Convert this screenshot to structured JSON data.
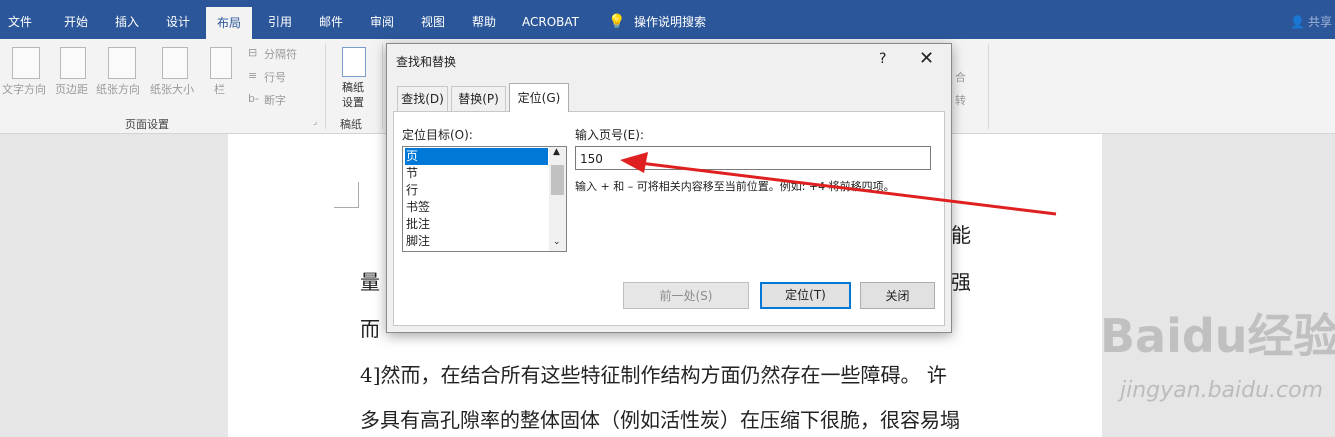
{
  "tabs": [
    "文件",
    "开始",
    "插入",
    "设计",
    "布局",
    "引用",
    "邮件",
    "审阅",
    "视图",
    "帮助",
    "ACROBAT",
    "操作说明搜索"
  ],
  "active_tab": "布局",
  "share_label": "共享",
  "ribbon": {
    "page_setup": [
      "文字方向",
      "页边距",
      "纸张方向",
      "纸张大小",
      "栏"
    ],
    "small_buttons": [
      "分隔符",
      "行号",
      "断字"
    ],
    "group_page_setup": "页面设置",
    "draft": [
      "稿纸",
      "设置"
    ],
    "group_draft": "稿纸",
    "right_fragments": [
      "合",
      "转"
    ]
  },
  "document": {
    "lines": [
      "能",
      "量",
      "强",
      "而",
      "4]然而，在结合所有这些特征制作结构方面仍然存在一些障碍。 许",
      "多具有高孔隙率的整体固体（例如活性炭）在压缩下很脆，很容易塌"
    ]
  },
  "dialog": {
    "title": "查找和替换",
    "help": "?",
    "close": "✕",
    "tabs": [
      "查找(D)",
      "替换(P)",
      "定位(G)"
    ],
    "active_tab": "定位(G)",
    "goto_what_label": "定位目标(O):",
    "goto_items": [
      "页",
      "节",
      "行",
      "书签",
      "批注",
      "脚注"
    ],
    "selected_item": "页",
    "page_number_label": "输入页号(E):",
    "page_number_value": "150",
    "hint": "输入 + 和 – 可将相关内容移至当前位置。例如: +4 将前移四项。",
    "buttons": {
      "previous": "前一处(S)",
      "goto": "定位(T)",
      "close": "关闭"
    }
  },
  "watermark": {
    "brand": "Baidu经验",
    "url": "jingyan.baidu.com"
  },
  "colors": {
    "title_bar": "#2b579a",
    "selection": "#0078d7",
    "annotation_arrow": "#e02020"
  }
}
